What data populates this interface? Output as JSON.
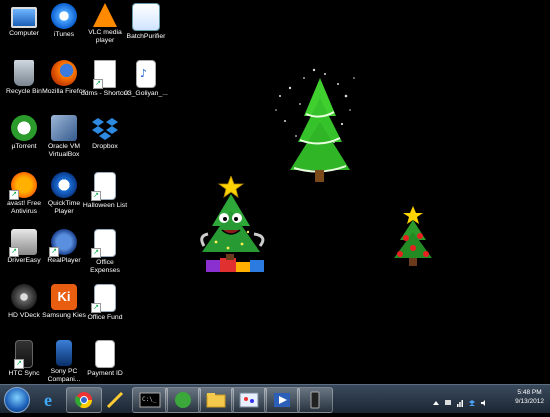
{
  "desktop": {
    "icons": [
      {
        "label": "Computer",
        "icon": "computer-icon"
      },
      {
        "label": "iTunes",
        "icon": "itunes-icon"
      },
      {
        "label": "VLC media player",
        "icon": "vlc-icon"
      },
      {
        "label": "BatchPurifier",
        "icon": "batchpurifier-icon"
      },
      {
        "label": "Recycle Bin",
        "icon": "recycle-bin-icon"
      },
      {
        "label": "Mozilla Firefox",
        "icon": "firefox-icon"
      },
      {
        "label": "ddms - Shortcut",
        "icon": "shortcut-icon"
      },
      {
        "label": "03_Goliyan_...",
        "icon": "mp3-file-icon"
      },
      {
        "label": "µTorrent",
        "icon": "utorrent-icon"
      },
      {
        "label": "Oracle VM VirtualBox",
        "icon": "virtualbox-icon"
      },
      {
        "label": "Dropbox",
        "icon": "dropbox-icon"
      },
      {
        "label": "avast! Free Antivirus",
        "icon": "avast-icon"
      },
      {
        "label": "QuickTime Player",
        "icon": "quicktime-icon"
      },
      {
        "label": "Halloween List",
        "icon": "document-icon"
      },
      {
        "label": "DriverEasy",
        "icon": "drivereasy-icon"
      },
      {
        "label": "RealPlayer",
        "icon": "realplayer-icon"
      },
      {
        "label": "Office Expenses",
        "icon": "document-icon"
      },
      {
        "label": "HD VDeck",
        "icon": "hdvdeck-icon"
      },
      {
        "label": "Samsung Kies",
        "icon": "samsung-kies-icon"
      },
      {
        "label": "Office Fund",
        "icon": "document-icon"
      },
      {
        "label": "HTC Sync",
        "icon": "htc-sync-icon"
      },
      {
        "label": "Sony PC Compani...",
        "icon": "sony-pc-companion-icon"
      },
      {
        "label": "Payment ID",
        "icon": "page-icon"
      }
    ]
  },
  "taskbar": {
    "pinned": [
      "ie-icon",
      "chrome-icon",
      "pen-tool-icon",
      "cmd-icon",
      "green-app-icon",
      "explorer-icon",
      "paint-icon",
      "media-icon",
      "phone-icon"
    ],
    "clock_time": "5:48 PM",
    "clock_date": "9/13/2012"
  },
  "colors": {
    "desktop_bg": "#000000",
    "taskbar_top": "#3a4a5c",
    "taskbar_bottom": "#1b2633",
    "tree_green": "#2fbf2f",
    "star_yellow": "#ffd400"
  }
}
